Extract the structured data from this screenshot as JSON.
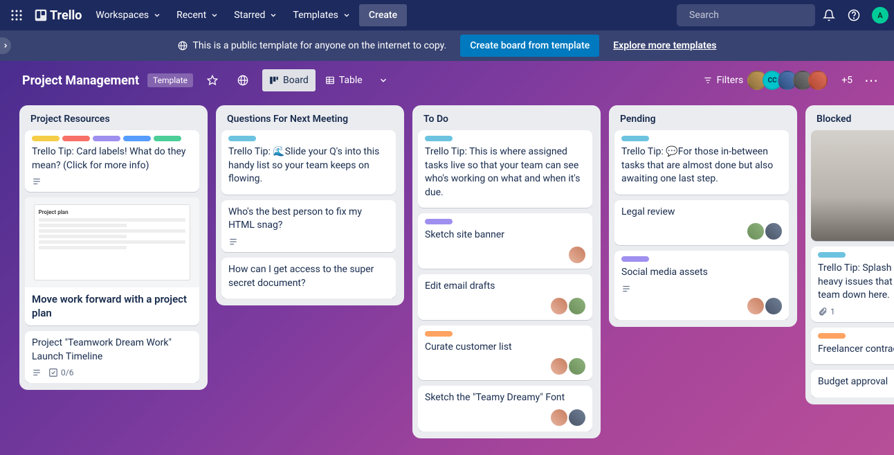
{
  "nav": {
    "brand": "Trello",
    "items": [
      "Workspaces",
      "Recent",
      "Starred",
      "Templates"
    ],
    "create": "Create",
    "search_placeholder": "Search",
    "avatar_initial": "A"
  },
  "banner": {
    "text": "This is a public template for anyone on the internet to copy.",
    "cta": "Create board from template",
    "link": "Explore more templates"
  },
  "board": {
    "title": "Project Management",
    "template_badge": "Template",
    "views": {
      "board": "Board",
      "table": "Table"
    },
    "filters": "Filters",
    "plus_count": "+5"
  },
  "lists": [
    {
      "title": "Project Resources",
      "cards": [
        {
          "labels": [
            "yellow",
            "red",
            "purple",
            "blue",
            "green"
          ],
          "title": "Trello Tip: Card labels! What do they mean? (Click for more info)",
          "desc": true
        },
        {
          "cover": "doc",
          "title": "Move work forward with a project plan",
          "big": true
        },
        {
          "title": "Project \"Teamwork Dream Work\" Launch Timeline",
          "desc": true,
          "checklist": "0/6"
        }
      ]
    },
    {
      "title": "Questions For Next Meeting",
      "cards": [
        {
          "labels": [
            "sky"
          ],
          "title": "Trello Tip: 🌊Slide your Q's into this handy list so your team keeps on flowing."
        },
        {
          "title": "Who's the best person to fix my HTML snag?",
          "desc": true
        },
        {
          "title": "How can I get access to the super secret document?"
        }
      ]
    },
    {
      "title": "To Do",
      "cards": [
        {
          "labels": [
            "sky"
          ],
          "title": "Trello Tip: This is where assigned tasks live so that your team can see who's working on what and when it's due."
        },
        {
          "labels": [
            "purple"
          ],
          "title": "Sketch site banner",
          "members": [
            "p1"
          ]
        },
        {
          "title": "Edit email drafts",
          "members": [
            "p1",
            "p3"
          ]
        },
        {
          "labels": [
            "orange"
          ],
          "title": "Curate customer list",
          "members": [
            "p1",
            "p3"
          ]
        },
        {
          "title": "Sketch the \"Teamy Dreamy\" Font",
          "members": [
            "p1",
            "p4"
          ]
        }
      ]
    },
    {
      "title": "Pending",
      "cards": [
        {
          "labels": [
            "sky"
          ],
          "title": "Trello Tip: 💬For those in-between tasks that are almost done but also awaiting one last step."
        },
        {
          "title": "Legal review",
          "members": [
            "p3",
            "p4"
          ]
        },
        {
          "labels": [
            "purple"
          ],
          "title": "Social media assets",
          "desc": true,
          "members": [
            "p1",
            "p4"
          ]
        }
      ]
    },
    {
      "title": "Blocked",
      "cards": [
        {
          "cover": "photo"
        },
        {
          "labels": [
            "sky"
          ],
          "title": "Trello Tip: Splash those redtape-heavy issues that are slowing your team down here.",
          "attach": "1"
        },
        {
          "labels": [
            "orange"
          ],
          "title": "Freelancer contracts"
        },
        {
          "title": "Budget approval"
        }
      ]
    }
  ]
}
